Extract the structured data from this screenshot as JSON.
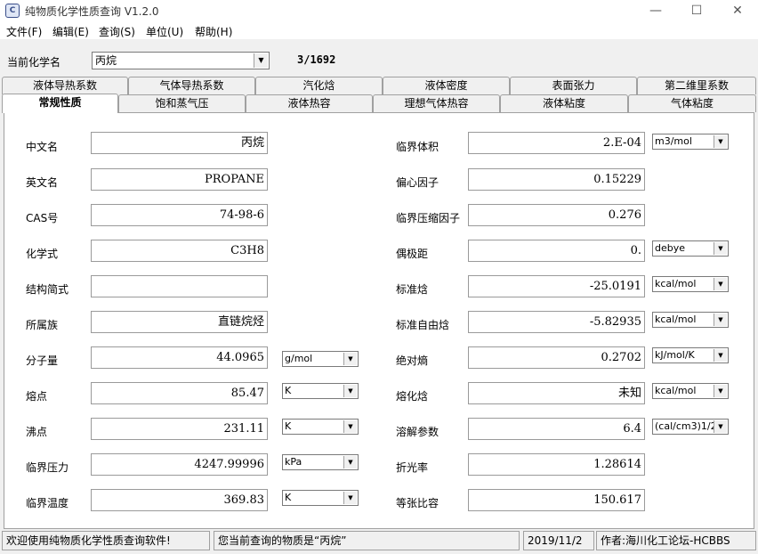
{
  "window": {
    "title": "纯物质化学性质查询 V1.2.0"
  },
  "menu": [
    "文件(F)",
    "编辑(E)",
    "查询(S)",
    "单位(U)",
    "帮助(H)"
  ],
  "selector": {
    "label": "当前化学名",
    "value": "丙烷",
    "counter": "3/1692"
  },
  "tabs_row1": [
    "液体导热系数",
    "气体导热系数",
    "汽化焓",
    "液体密度",
    "表面张力",
    "第二维里系数"
  ],
  "tabs_row2": [
    "常规性质",
    "饱和蒸气压",
    "液体热容",
    "理想气体热容",
    "液体粘度",
    "气体粘度"
  ],
  "left_fields": [
    {
      "label": "中文名",
      "value": "丙烷",
      "unit": ""
    },
    {
      "label": "英文名",
      "value": "PROPANE",
      "unit": ""
    },
    {
      "label": "CAS号",
      "value": "74-98-6",
      "unit": ""
    },
    {
      "label": "化学式",
      "value": "C3H8",
      "unit": ""
    },
    {
      "label": "结构简式",
      "value": "",
      "unit": ""
    },
    {
      "label": "所属族",
      "value": "直链烷烃",
      "unit": ""
    },
    {
      "label": "分子量",
      "value": "44.0965",
      "unit": "g/mol"
    },
    {
      "label": "熔点",
      "value": "85.47",
      "unit": "K"
    },
    {
      "label": "沸点",
      "value": "231.11",
      "unit": "K"
    },
    {
      "label": "临界压力",
      "value": "4247.99996",
      "unit": "kPa"
    },
    {
      "label": "临界温度",
      "value": "369.83",
      "unit": "K"
    }
  ],
  "right_fields": [
    {
      "label": "临界体积",
      "value": "2.E-04",
      "unit": "m3/mol"
    },
    {
      "label": "偏心因子",
      "value": "0.15229",
      "unit": ""
    },
    {
      "label": "临界压缩因子",
      "value": "0.276",
      "unit": ""
    },
    {
      "label": "偶极距",
      "value": "0.",
      "unit": "debye"
    },
    {
      "label": "标准焓",
      "value": "-25.0191",
      "unit": "kcal/mol"
    },
    {
      "label": "标准自由焓",
      "value": "-5.82935",
      "unit": "kcal/mol"
    },
    {
      "label": "绝对熵",
      "value": "0.2702",
      "unit": "kJ/mol/K"
    },
    {
      "label": "熔化焓",
      "value": "未知",
      "unit": "kcal/mol"
    },
    {
      "label": "溶解参数",
      "value": "6.4",
      "unit": "(cal/cm3)1/2"
    },
    {
      "label": "折光率",
      "value": "1.28614",
      "unit": ""
    },
    {
      "label": "等张比容",
      "value": "150.617",
      "unit": ""
    }
  ],
  "status": {
    "welcome": "欢迎使用纯物质化学性质查询软件!",
    "query": "您当前查询的物质是“丙烷”",
    "date": "2019/11/2",
    "author": "作者:海川化工论坛-HCBBS"
  }
}
